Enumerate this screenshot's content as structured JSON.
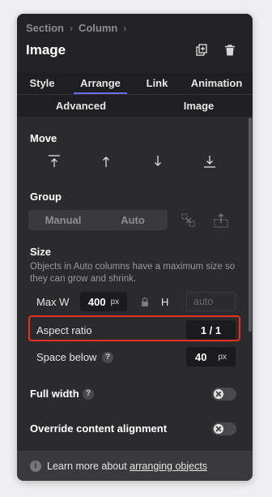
{
  "breadcrumb": {
    "items": [
      "Section",
      "Column"
    ],
    "separator": "›"
  },
  "header": {
    "title": "Image"
  },
  "tabs_primary": [
    "Style",
    "Arrange",
    "Link",
    "Animation"
  ],
  "tabs_primary_active": "Arrange",
  "tabs_secondary": [
    "Advanced",
    "Image"
  ],
  "move": {
    "label": "Move",
    "icons": [
      "move-top-icon",
      "move-up-icon",
      "move-down-icon",
      "move-bottom-icon"
    ]
  },
  "group": {
    "label": "Group",
    "options": [
      "Manual",
      "Auto"
    ],
    "icons": [
      "ungroup-icon",
      "export-icon"
    ]
  },
  "size": {
    "label": "Size",
    "description": "Objects in Auto columns have a maximum size so they can grow and shrink.",
    "max_w_label": "Max W",
    "max_w_value": "400",
    "max_w_unit": "px",
    "h_label": "H",
    "h_placeholder": "auto",
    "aspect_label": "Aspect ratio",
    "aspect_value": "1 / 1",
    "space_label": "Space below",
    "space_value": "40",
    "space_unit": "px",
    "help_glyph": "?"
  },
  "full_width": {
    "label": "Full width",
    "help_glyph": "?"
  },
  "override": {
    "label": "Override content alignment"
  },
  "footer": {
    "info_glyph": "i",
    "text": "Learn more about ",
    "link": "arranging objects"
  },
  "colors": {
    "accent": "#6c6cff",
    "highlight": "#e8321f",
    "panel": "#2b2b2d"
  }
}
